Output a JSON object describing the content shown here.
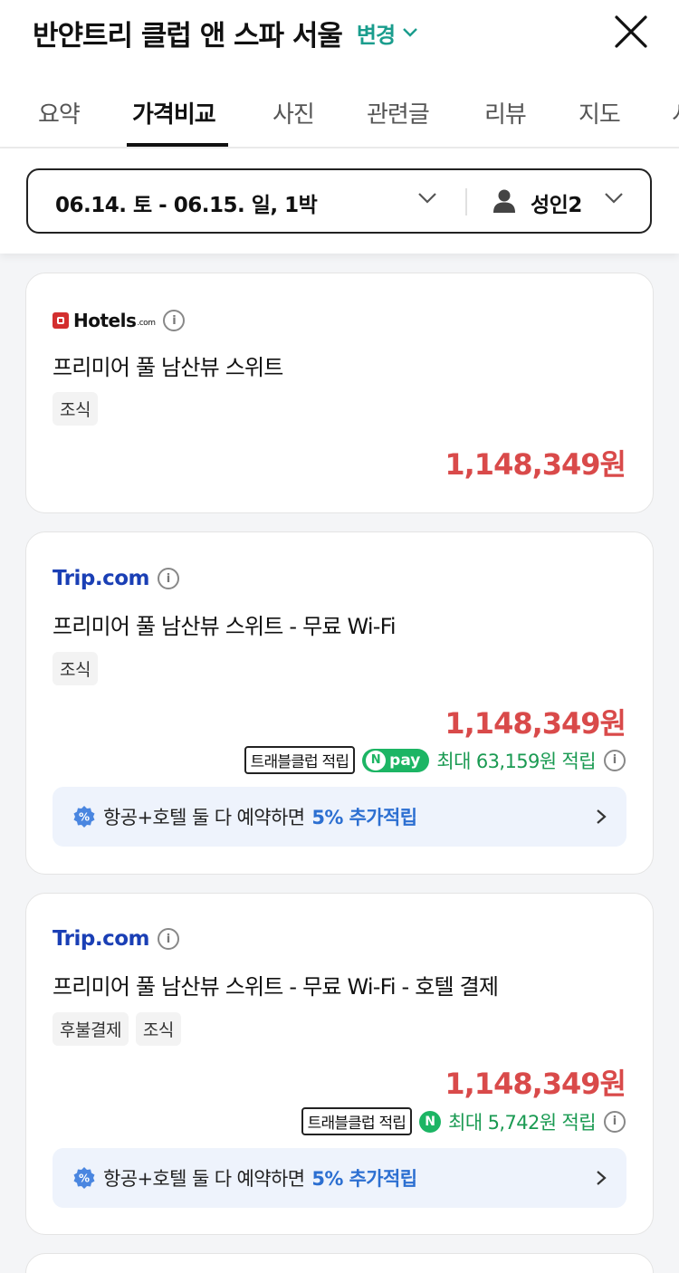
{
  "header": {
    "title": "반얀트리 클럽 앤 스파 서울",
    "change_label": "변경"
  },
  "tabs": [
    {
      "label": "요약",
      "active": false
    },
    {
      "label": "가격비교",
      "active": true
    },
    {
      "label": "사진",
      "active": false
    },
    {
      "label": "관련글",
      "active": false
    },
    {
      "label": "리뷰",
      "active": false
    },
    {
      "label": "지도",
      "active": false
    },
    {
      "label": "시",
      "active": false
    }
  ],
  "filter": {
    "dates": "06.14. 토 - 06.15. 일, 1박",
    "guests": "성인2"
  },
  "offers": [
    {
      "provider": "Hotels",
      "provider_suffix": ".com",
      "room": "프리미어 풀 남산뷰 스위트",
      "tags": [
        "조식"
      ],
      "price": "1,148,349원"
    },
    {
      "provider": "Trip.com",
      "room": "프리미어 풀 남산뷰 스위트 - 무료 Wi-Fi",
      "tags": [
        "조식"
      ],
      "price": "1,148,349원",
      "club_label": "트래블클럽 적립",
      "npay_label": "pay",
      "reward_text": "최대 63,159원 적립",
      "promo_text": "항공+호텔 둘 다 예약하면",
      "promo_highlight": "5% 추가적립"
    },
    {
      "provider": "Trip.com",
      "room": "프리미어 풀 남산뷰 스위트 - 무료 Wi-Fi - 호텔 결제",
      "tags": [
        "후불결제",
        "조식"
      ],
      "price": "1,148,349원",
      "club_label": "트래블클럽 적립",
      "reward_text": "최대 5,742원 적립",
      "promo_text": "항공+호텔 둘 다 예약하면",
      "promo_highlight": "5% 추가적립"
    }
  ],
  "colors": {
    "accent_teal": "#1a9d8d",
    "price_red": "#d94a4a",
    "npay_green": "#1cb564",
    "promo_blue": "#2c6fd1",
    "trip_blue": "#1a3fb5"
  }
}
